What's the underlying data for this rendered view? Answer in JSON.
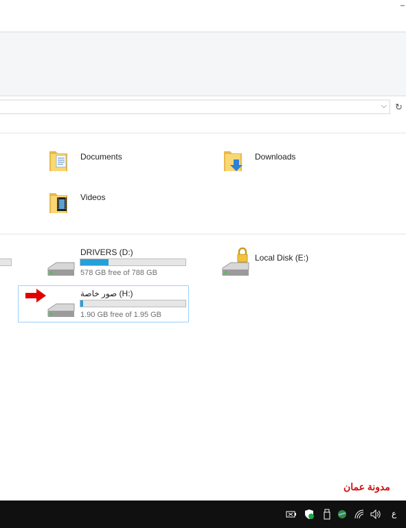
{
  "window": {
    "titlebar_glyph": "‒"
  },
  "address": {
    "dropdown_glyph": "⌵",
    "refresh_glyph": "↻"
  },
  "folders": [
    {
      "name": "Documents",
      "icon": "documents-folder-icon"
    },
    {
      "name": "Downloads",
      "icon": "downloads-folder-icon"
    },
    {
      "name": "Videos",
      "icon": "videos-folder-icon"
    }
  ],
  "drives": [
    {
      "label": "DRIVERS (D:)",
      "free_text": "578 GB free of 788 GB",
      "used_fraction": 0.27,
      "icon": "hard-drive-icon"
    },
    {
      "label": "Local Disk (E:)",
      "icon": "locked-hard-drive-icon"
    },
    {
      "label": "صور خاصة (H:)",
      "free_text": "1.90 GB free of 1.95 GB",
      "used_fraction": 0.026,
      "icon": "hard-drive-icon",
      "selected": true
    }
  ],
  "watermark": "مدونة عمان",
  "taskbar": {
    "lang_indicator": "ع"
  },
  "colors": {
    "accent": "#26a0da",
    "arrow": "#e00000",
    "selection_border": "#99d1ff"
  }
}
